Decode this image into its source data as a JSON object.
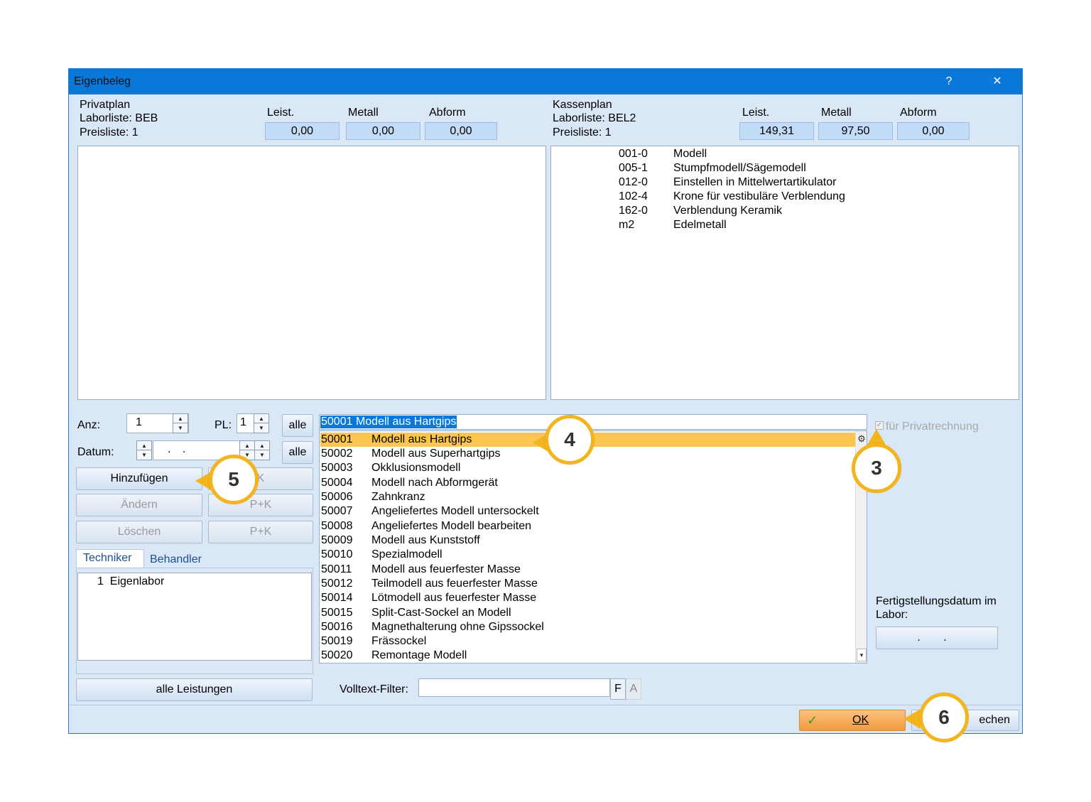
{
  "window": {
    "title": "Eigenbeleg",
    "help": "?",
    "close": "✕"
  },
  "privat": {
    "plan": "Privatplan",
    "laborliste": "Laborliste: BEB",
    "preisliste": "Preisliste: 1",
    "leist_label": "Leist.",
    "metall_label": "Metall",
    "abform_label": "Abform",
    "leist": "0,00",
    "metall": "0,00",
    "abform": "0,00"
  },
  "kasse": {
    "plan": "Kassenplan",
    "laborliste": "Laborliste: BEL2",
    "preisliste": "Preisliste: 1",
    "leist_label": "Leist.",
    "metall_label": "Metall",
    "abform_label": "Abform",
    "leist": "149,31",
    "metall": "97,50",
    "abform": "0,00",
    "items": [
      {
        "code": "001-0",
        "name": "Modell"
      },
      {
        "code": "005-1",
        "name": "Stumpfmodell/Sägemodell"
      },
      {
        "code": "012-0",
        "name": "Einstellen in Mittelwertartikulator"
      },
      {
        "code": "102-4",
        "name": "Krone für vestibuläre Verblendung"
      },
      {
        "code": "162-0",
        "name": "Verblendung Keramik"
      },
      {
        "code": "m2",
        "name": "Edelmetall"
      }
    ]
  },
  "form": {
    "anz_label": "Anz:",
    "anz_value": "1",
    "pl_label": "PL:",
    "pl_value": "1",
    "alle": "alle",
    "datum_label": "Datum:",
    "datum_value": ". .",
    "hinzufuegen": "Hinzufügen",
    "k": "K",
    "aendern": "Ändern",
    "loeschen": "Löschen",
    "pk": "P+K",
    "alle_leistungen": "alle Leistungen"
  },
  "tabs": {
    "techniker": "Techniker",
    "behandler": "Behandler"
  },
  "techniker_list": [
    {
      "num": "1",
      "name": "Eigenlabor"
    }
  ],
  "search": {
    "value": "50001 Modell aus Hartgips"
  },
  "list": [
    {
      "code": "50001",
      "name": "Modell aus Hartgips"
    },
    {
      "code": "50002",
      "name": "Modell aus Superhartgips"
    },
    {
      "code": "50003",
      "name": "Okklusionsmodell"
    },
    {
      "code": "50004",
      "name": "Modell nach Abformgerät"
    },
    {
      "code": "50006",
      "name": "Zahnkranz"
    },
    {
      "code": "50007",
      "name": "Angeliefertes Modell untersockelt"
    },
    {
      "code": "50008",
      "name": "Angeliefertes Modell bearbeiten"
    },
    {
      "code": "50009",
      "name": "Modell aus Kunststoff"
    },
    {
      "code": "50010",
      "name": "Spezialmodell"
    },
    {
      "code": "50011",
      "name": "Modell aus feuerfester Masse"
    },
    {
      "code": "50012",
      "name": "Teilmodell aus feuerfester Masse"
    },
    {
      "code": "50014",
      "name": "Lötmodell aus feuerfester Masse"
    },
    {
      "code": "50015",
      "name": "Split-Cast-Sockel an Modell"
    },
    {
      "code": "50016",
      "name": "Magnethalterung ohne Gipssockel"
    },
    {
      "code": "50019",
      "name": "Frässockel"
    },
    {
      "code": "50020",
      "name": "Remontage Modell"
    }
  ],
  "privatrechnung": "für Privatrechnung",
  "fertig_label": "Fertigstellungsdatum im Labor:",
  "fertig_value": ". .",
  "filter": {
    "label": "Volltext-Filter:",
    "f": "F",
    "a": "A"
  },
  "footer": {
    "ok": "OK",
    "abbrechen_partial": "echen"
  },
  "callouts": {
    "c3": "3",
    "c4": "4",
    "c5": "5",
    "c6": "6"
  },
  "colors": {
    "titlebar": "#0a78d8",
    "selected_row": "#fcc64e",
    "callout_border": "#f2b51e",
    "ok_button": "#f7a64a"
  }
}
